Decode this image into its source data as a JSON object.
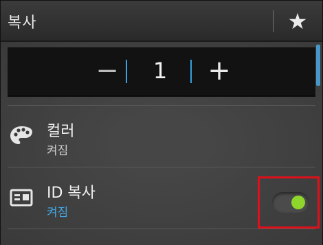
{
  "header": {
    "title": "복사",
    "favorite_icon": "star-icon"
  },
  "stepper": {
    "minus_label": "−",
    "value": "1",
    "plus_label": "+"
  },
  "items": [
    {
      "label": "컬러",
      "value": "켜짐",
      "icon": "palette-icon"
    },
    {
      "label": "ID 복사",
      "value": "켜짐",
      "icon": "id-card-icon",
      "toggle_on": true
    }
  ],
  "colors": {
    "accent": "#36a3e0",
    "toggle_on": "#8ed62c",
    "highlight_border": "#e0101b"
  }
}
